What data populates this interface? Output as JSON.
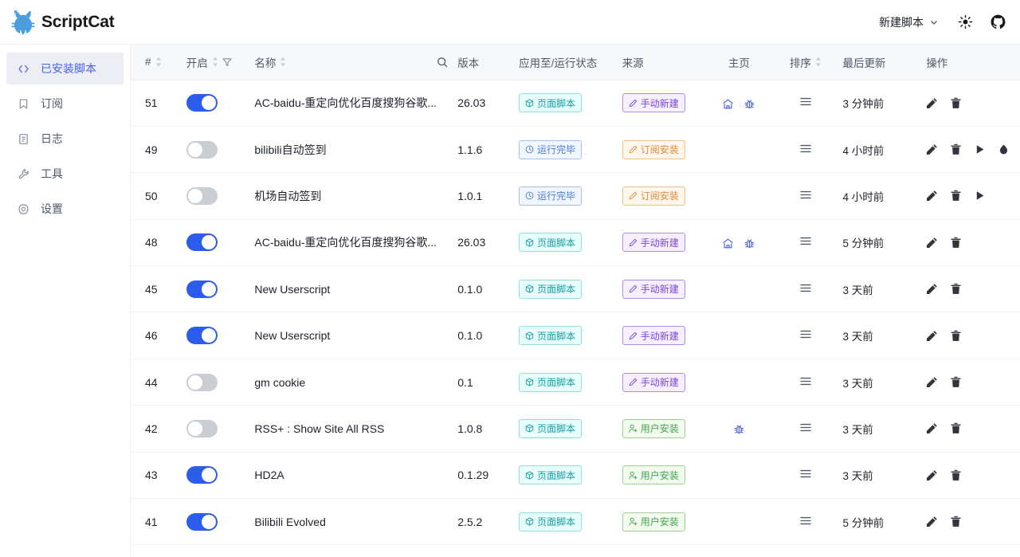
{
  "header": {
    "brand": "ScriptCat",
    "logo_icon": "cat-logo-icon",
    "new_script_label": "新建脚本",
    "chevron_icon": "chevron-down-icon",
    "theme_icon": "sun-theme-icon",
    "github_icon": "github-icon",
    "brand_color": "#4a9ede"
  },
  "sidebar": {
    "items": [
      {
        "label": "已安装脚本",
        "icon": "code-icon",
        "active": true
      },
      {
        "label": "订阅",
        "icon": "bookmark-icon",
        "active": false
      },
      {
        "label": "日志",
        "icon": "log-file-icon",
        "active": false
      },
      {
        "label": "工具",
        "icon": "wrench-icon",
        "active": false
      },
      {
        "label": "设置",
        "icon": "gear-icon",
        "active": false
      }
    ],
    "active_color": "#4c61e8",
    "active_bg": "#eceef4"
  },
  "table": {
    "columns": [
      {
        "key": "index",
        "label": "#",
        "sortable": true,
        "filter": false
      },
      {
        "key": "enable",
        "label": "开启",
        "sortable": true,
        "filter": true
      },
      {
        "key": "name",
        "label": "名称",
        "sortable": true,
        "search": true
      },
      {
        "key": "version",
        "label": "版本",
        "sortable": false,
        "filter": false
      },
      {
        "key": "runstatus",
        "label": "应用至/运行状态",
        "sortable": false,
        "filter": false
      },
      {
        "key": "source",
        "label": "来源",
        "sortable": false,
        "filter": false
      },
      {
        "key": "home",
        "label": "主页",
        "sortable": false,
        "filter": false
      },
      {
        "key": "sort",
        "label": "排序",
        "sortable": true,
        "filter": false
      },
      {
        "key": "updated",
        "label": "最后更新",
        "sortable": false,
        "filter": false
      },
      {
        "key": "actions",
        "label": "操作",
        "sortable": false,
        "filter": false
      }
    ],
    "search_icon": "search-icon",
    "filter_icon": "filter-icon",
    "sorter_icon": "sort-arrows-icon",
    "drag_icon": "drag-handle-icon",
    "rows": [
      {
        "index": "51",
        "enabled": true,
        "name": "AC-baidu-重定向优化百度搜狗谷歌...",
        "version": "26.03",
        "run_status": {
          "label": "页面脚本",
          "style": "cyan",
          "icon": "box-icon"
        },
        "source": {
          "label": "手动新建",
          "style": "purple",
          "icon": "pencil-icon"
        },
        "home_icons": [
          "home-icon",
          "bug-icon"
        ],
        "updated": "3 分钟前",
        "actions": [
          "edit-icon",
          "delete-icon"
        ]
      },
      {
        "index": "49",
        "enabled": false,
        "name": "bilibili自动签到",
        "version": "1.1.6",
        "run_status": {
          "label": "运行完毕",
          "style": "blue",
          "icon": "clock-icon"
        },
        "source": {
          "label": "订阅安装",
          "style": "orange",
          "icon": "pencil-icon"
        },
        "home_icons": [],
        "updated": "4 小时前",
        "actions": [
          "edit-icon",
          "delete-icon",
          "run-icon",
          "cloud-icon"
        ]
      },
      {
        "index": "50",
        "enabled": false,
        "name": "机场自动签到",
        "version": "1.0.1",
        "run_status": {
          "label": "运行完毕",
          "style": "blue",
          "icon": "clock-icon"
        },
        "source": {
          "label": "订阅安装",
          "style": "orange",
          "icon": "pencil-icon"
        },
        "home_icons": [],
        "updated": "4 小时前",
        "actions": [
          "edit-icon",
          "delete-icon",
          "run-icon"
        ]
      },
      {
        "index": "48",
        "enabled": true,
        "name": "AC-baidu-重定向优化百度搜狗谷歌...",
        "version": "26.03",
        "run_status": {
          "label": "页面脚本",
          "style": "cyan",
          "icon": "box-icon"
        },
        "source": {
          "label": "手动新建",
          "style": "purple",
          "icon": "pencil-icon"
        },
        "home_icons": [
          "home-icon",
          "bug-icon"
        ],
        "updated": "5 分钟前",
        "actions": [
          "edit-icon",
          "delete-icon"
        ]
      },
      {
        "index": "45",
        "enabled": true,
        "name": "New Userscript",
        "version": "0.1.0",
        "run_status": {
          "label": "页面脚本",
          "style": "cyan",
          "icon": "box-icon"
        },
        "source": {
          "label": "手动新建",
          "style": "purple",
          "icon": "pencil-icon"
        },
        "home_icons": [],
        "updated": "3 天前",
        "actions": [
          "edit-icon",
          "delete-icon"
        ]
      },
      {
        "index": "46",
        "enabled": true,
        "name": "New Userscript",
        "version": "0.1.0",
        "run_status": {
          "label": "页面脚本",
          "style": "cyan",
          "icon": "box-icon"
        },
        "source": {
          "label": "手动新建",
          "style": "purple",
          "icon": "pencil-icon"
        },
        "home_icons": [],
        "updated": "3 天前",
        "actions": [
          "edit-icon",
          "delete-icon"
        ]
      },
      {
        "index": "44",
        "enabled": false,
        "name": "gm cookie",
        "version": "0.1",
        "run_status": {
          "label": "页面脚本",
          "style": "cyan",
          "icon": "box-icon"
        },
        "source": {
          "label": "手动新建",
          "style": "purple",
          "icon": "pencil-icon"
        },
        "home_icons": [],
        "updated": "3 天前",
        "actions": [
          "edit-icon",
          "delete-icon"
        ]
      },
      {
        "index": "42",
        "enabled": false,
        "name": "RSS+ : Show Site All RSS",
        "version": "1.0.8",
        "run_status": {
          "label": "页面脚本",
          "style": "cyan",
          "icon": "box-icon"
        },
        "source": {
          "label": "用户安装",
          "style": "green",
          "icon": "user-add-icon"
        },
        "home_icons": [
          "bug-icon"
        ],
        "updated": "3 天前",
        "actions": [
          "edit-icon",
          "delete-icon"
        ]
      },
      {
        "index": "43",
        "enabled": true,
        "name": "HD2A",
        "version": "0.1.29",
        "run_status": {
          "label": "页面脚本",
          "style": "cyan",
          "icon": "box-icon"
        },
        "source": {
          "label": "用户安装",
          "style": "green",
          "icon": "user-add-icon"
        },
        "home_icons": [],
        "updated": "3 天前",
        "actions": [
          "edit-icon",
          "delete-icon"
        ]
      },
      {
        "index": "41",
        "enabled": true,
        "name": "Bilibili Evolved",
        "version": "2.5.2",
        "run_status": {
          "label": "页面脚本",
          "style": "cyan",
          "icon": "box-icon"
        },
        "source": {
          "label": "用户安装",
          "style": "green",
          "icon": "user-add-icon"
        },
        "home_icons": [],
        "updated": "5 分钟前",
        "actions": [
          "edit-icon",
          "delete-icon"
        ]
      }
    ]
  },
  "colors": {
    "toggle_on": "#2b5ceb",
    "toggle_off": "#c9cdd4",
    "header_bg": "#f7f8fa",
    "accent": "#4c61e8"
  }
}
